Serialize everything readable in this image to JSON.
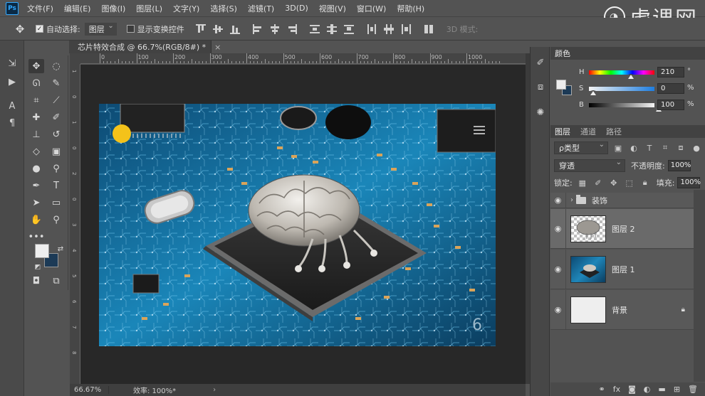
{
  "app": {
    "logo": "Ps",
    "menu": [
      "文件(F)",
      "编辑(E)",
      "图像(I)",
      "图层(L)",
      "文字(Y)",
      "选择(S)",
      "滤镜(T)",
      "3D(D)",
      "视图(V)",
      "窗口(W)",
      "帮助(H)"
    ],
    "watermark": "虎课网"
  },
  "options": {
    "auto_select_label": "自动选择:",
    "auto_select_value": "图层",
    "show_transform_label": "显示变换控件",
    "mode_3d_label": "3D 模式:"
  },
  "document": {
    "tab_title": "芯片特效合成 @ 66.7%(RGB/8#) *",
    "close": "×",
    "zoom": "66.67%",
    "efficiency": "效率: 100%*",
    "status_arrow": "›"
  },
  "ruler": {
    "top_labels": [
      "0",
      "100",
      "200",
      "300",
      "400",
      "500",
      "600",
      "700",
      "800",
      "900",
      "1000"
    ],
    "left_labels": [
      "1",
      "0",
      "1",
      "0",
      "2",
      "0",
      "3",
      "4",
      "5",
      "6",
      "7",
      "8"
    ]
  },
  "color_panel": {
    "title": "颜色",
    "h": {
      "label": "H",
      "value": "210",
      "unit": "°",
      "level": 0.58
    },
    "s": {
      "label": "S",
      "value": "0",
      "unit": "%",
      "level": 0.0
    },
    "b": {
      "label": "B",
      "value": "100",
      "unit": "%",
      "level": 1.0
    },
    "fg_color": "#ececec",
    "bg_color": "#1c3a56"
  },
  "layers_panel": {
    "tabs": [
      "图层",
      "通道",
      "路径"
    ],
    "filter_label": "ρ类型",
    "blend_mode": "穿透",
    "opacity_label": "不透明度:",
    "opacity_value": "100%",
    "lock_label": "锁定:",
    "fill_label": "填充:",
    "fill_value": "100%",
    "layers": [
      {
        "name": "装饰",
        "type": "group",
        "visible": true
      },
      {
        "name": "图层 2",
        "type": "layer",
        "visible": true
      },
      {
        "name": "图层 1",
        "type": "layer",
        "visible": true
      },
      {
        "name": "背景",
        "type": "background",
        "visible": true,
        "locked": true
      }
    ]
  },
  "colors": {
    "ui_bg": "#535353",
    "board_blue": "#1f6f9f",
    "chip_dark": "#2a2a2a"
  }
}
